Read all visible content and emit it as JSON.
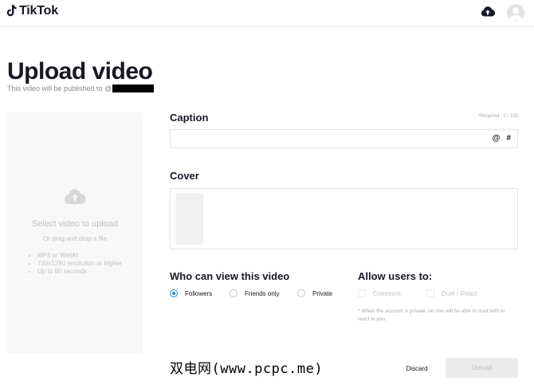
{
  "header": {
    "brand": "TikTok",
    "icons": {
      "logo": "tiktok-note-icon",
      "upload": "cloud-upload-icon",
      "profile": "avatar-icon"
    }
  },
  "page": {
    "title": "Upload video",
    "subtitle": "This video will be published to @"
  },
  "upload_area": {
    "heading": "Select video to upload",
    "subtext": "Or drag and drop a file",
    "requirements": [
      "MP4 or WebM",
      "720x1280 resolution or higher",
      "Up to 60 seconds"
    ]
  },
  "caption": {
    "label": "Caption",
    "hint": "*Required · 0 / 150",
    "value": "",
    "mention_symbol": "@",
    "hashtag_symbol": "#"
  },
  "cover": {
    "label": "Cover"
  },
  "privacy": {
    "label": "Who can view this video",
    "options": [
      {
        "label": "Followers",
        "selected": true
      },
      {
        "label": "Friends only",
        "selected": false
      },
      {
        "label": "Private",
        "selected": false
      }
    ]
  },
  "allow": {
    "label": "Allow users to:",
    "options": [
      {
        "label": "Comment",
        "checked": false
      },
      {
        "label": "Duet / React",
        "checked": false
      }
    ],
    "note": "* When the account is private, no one will be able to duet with or react to you."
  },
  "actions": {
    "discard": "Discard",
    "upload": "Upload"
  },
  "watermark": "双电网(www.pcpc.me)",
  "colors": {
    "accent": "#1b8de0",
    "text": "#161823",
    "muted": "#a8a9ad"
  }
}
